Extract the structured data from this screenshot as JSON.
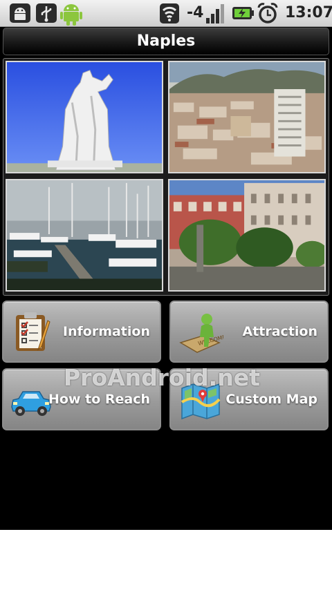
{
  "status_bar": {
    "signal_text": "-4",
    "time": "13:07",
    "icons": [
      "android-debug-icon",
      "usb-icon",
      "android-robot-icon",
      "wifi-icon",
      "signal-bars-icon",
      "battery-charging-icon",
      "alarm-clock-icon"
    ]
  },
  "header": {
    "title": "Naples"
  },
  "gallery": {
    "photos": [
      "statue-photo",
      "city-view-photo",
      "harbor-photo",
      "square-photo"
    ]
  },
  "menu": {
    "information_label": "Information",
    "attraction_label": "Attraction",
    "how_to_reach_label": "How to Reach",
    "custom_map_label": "Custom Map"
  },
  "watermark": "ProAndroid.net",
  "colors": {
    "background": "#000000",
    "button": "#9a9a9a",
    "title_text": "#ffffff"
  }
}
